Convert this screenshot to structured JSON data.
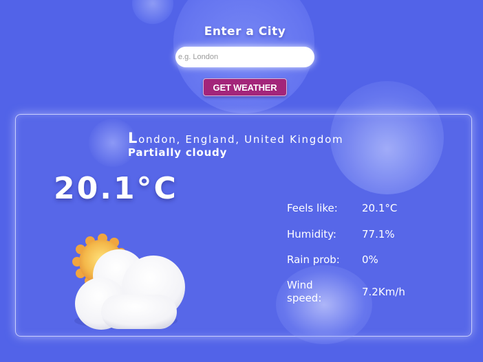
{
  "search": {
    "title": "Enter a City",
    "placeholder": "e.g. London",
    "value": "",
    "button_label": "GET WEATHER"
  },
  "weather": {
    "location_initial": "L",
    "location_rest": "ondon, England, United Kingdom",
    "condition": "Partially cloudy",
    "temperature": "20.1°C",
    "icon": "partly-cloudy-icon",
    "details": {
      "feels_like_label": "Feels like:",
      "feels_like_value": "20.1°C",
      "humidity_label": "Humidity:",
      "humidity_value": "77.1%",
      "rain_label": "Rain prob:",
      "rain_value": "0%",
      "wind_label": "Wind speed:",
      "wind_value": "7.2Km/h"
    }
  },
  "colors": {
    "background": "#5263e8",
    "button": "#a3257a",
    "text": "#ffffff"
  }
}
